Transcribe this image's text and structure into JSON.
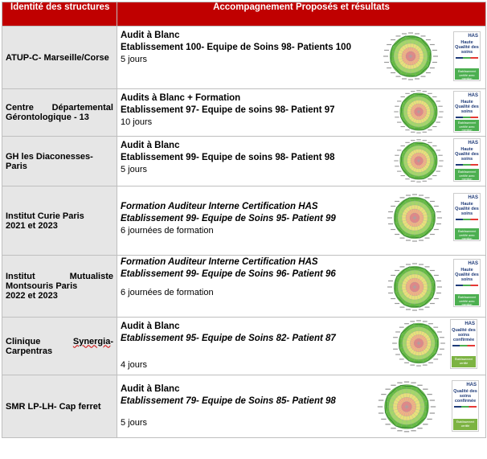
{
  "header": {
    "col1": "Identité des structures",
    "col2": "Accompagnement Proposés et résultats"
  },
  "rows": [
    {
      "name_a": "ATUP-C- Marseille/Corse",
      "name_b": "",
      "line1": "Audit à Blanc",
      "line2": "Etablissement 100- Equipe de Soins 98- Patients 100",
      "line3": "5 jours",
      "badge_logo": "HAS",
      "badge_title": "Haute Qualité des soins",
      "badge_sub": "Établissement certifié avec mention"
    },
    {
      "name_a": "Centre Départemental",
      "name_b": "Gérontologique - 13",
      "line1": "Audits à Blanc + Formation",
      "line2": "Etablissement 97- Equipe de soins 98- Patient 97",
      "line3": "10 jours",
      "badge_logo": "HAS",
      "badge_title": "Haute Qualité des soins",
      "badge_sub": "Établissement certifié avec mention"
    },
    {
      "name_a": "GH les Diaconesses- Paris",
      "name_b": "",
      "line1": "Audit à Blanc",
      "line2": "Etablissement 99- Equipe de soins 98- Patient 98",
      "line3": "5 jours",
      "badge_logo": "HAS",
      "badge_title": "Haute Qualité des soins",
      "badge_sub": "Établissement certifié avec mention"
    },
    {
      "name_a": "Institut Curie Paris",
      "name_b": "2021 et 2023",
      "line1": "Formation Auditeur Interne  Certification HAS",
      "line2": "Etablissement 99- Equipe de Soins 95- Patient 99",
      "line3": "6 journées de formation",
      "badge_logo": "HAS",
      "badge_title": "Haute Qualité des soins",
      "badge_sub": "Établissement certifié avec mention"
    },
    {
      "name_a": "Institut Mutualiste",
      "name_b": "Montsouris Paris",
      "name_c": "2022 et 2023",
      "line1": "Formation Auditeur Interne  Certification HAS",
      "line2": "Etablissement 99- Equipe de Soins 96- Patient 96",
      "line3": "6 journées de formation",
      "badge_logo": "HAS",
      "badge_title": "Haute Qualité des soins",
      "badge_sub": "Établissement certifié avec mention"
    },
    {
      "name_a": "Clinique Synergia-",
      "name_b": "Carpentras",
      "line1": "Audit à Blanc",
      "line2": "Etablissement 95- Equipe de Soins 82- Patient 87",
      "line3": "4 jours",
      "badge_logo": "HAS",
      "badge_title": "Qualité des soins confirmée",
      "badge_sub": "Établissement certifié"
    },
    {
      "name_a": "SMR LP-LH- Cap ferret",
      "name_b": "",
      "line1": "Audit à Blanc",
      "line2": "Etablissement 79- Equipe de Soins 85- Patient 98",
      "line3": "5 jours",
      "badge_logo": "HAS",
      "badge_title": "Qualité des soins confirmée",
      "badge_sub": "Établissement certifié"
    }
  ],
  "colors": {
    "header_bg": "#c00000",
    "col1_bg": "#e6e6e6",
    "badge_blue": "#1f3b78",
    "badge_green": "#4caf50"
  }
}
